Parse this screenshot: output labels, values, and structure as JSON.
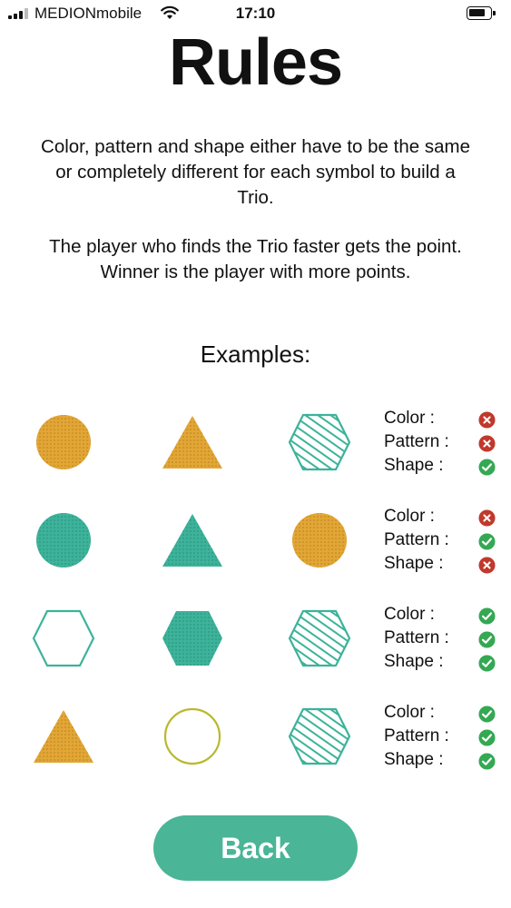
{
  "status_bar": {
    "carrier": "MEDIONmobile",
    "time": "17:10"
  },
  "title": "Rules",
  "paragraphs": [
    "Color, pattern and shape either have to be the same or completely different for each symbol to build a Trio.",
    "The player who finds the Trio faster gets the point. Winner is the player with more points."
  ],
  "examples_heading": "Examples:",
  "colors": {
    "orange": "#e3a634",
    "teal": "#3cb39a",
    "green_ok": "#34a853",
    "red_x": "#c0392b",
    "olive": "#b9b92e",
    "accent": "#4ab597"
  },
  "examples": [
    {
      "symbols": [
        {
          "shape": "circle",
          "color": "orange",
          "fill": "dotted"
        },
        {
          "shape": "triangle",
          "color": "orange",
          "fill": "dotted"
        },
        {
          "shape": "hexagon",
          "color": "teal",
          "fill": "striped"
        }
      ],
      "criteria": [
        {
          "label": "Color :",
          "status": "invalid"
        },
        {
          "label": "Pattern :",
          "status": "invalid"
        },
        {
          "label": "Shape :",
          "status": "valid"
        }
      ]
    },
    {
      "symbols": [
        {
          "shape": "circle",
          "color": "teal",
          "fill": "dotted"
        },
        {
          "shape": "triangle",
          "color": "teal",
          "fill": "dotted"
        },
        {
          "shape": "circle",
          "color": "orange",
          "fill": "dotted"
        }
      ],
      "criteria": [
        {
          "label": "Color :",
          "status": "invalid"
        },
        {
          "label": "Pattern :",
          "status": "valid"
        },
        {
          "label": "Shape :",
          "status": "invalid"
        }
      ]
    },
    {
      "symbols": [
        {
          "shape": "hexagon",
          "color": "teal",
          "fill": "outline"
        },
        {
          "shape": "hexagon",
          "color": "teal",
          "fill": "dotted"
        },
        {
          "shape": "hexagon",
          "color": "teal",
          "fill": "striped"
        }
      ],
      "criteria": [
        {
          "label": "Color :",
          "status": "valid"
        },
        {
          "label": "Pattern :",
          "status": "valid"
        },
        {
          "label": "Shape :",
          "status": "valid"
        }
      ]
    },
    {
      "symbols": [
        {
          "shape": "triangle",
          "color": "orange",
          "fill": "dotted"
        },
        {
          "shape": "circle",
          "color": "olive",
          "fill": "outline"
        },
        {
          "shape": "hexagon",
          "color": "teal",
          "fill": "striped"
        }
      ],
      "criteria": [
        {
          "label": "Color :",
          "status": "valid"
        },
        {
          "label": "Pattern :",
          "status": "valid"
        },
        {
          "label": "Shape :",
          "status": "valid"
        }
      ]
    }
  ],
  "back_button": "Back"
}
